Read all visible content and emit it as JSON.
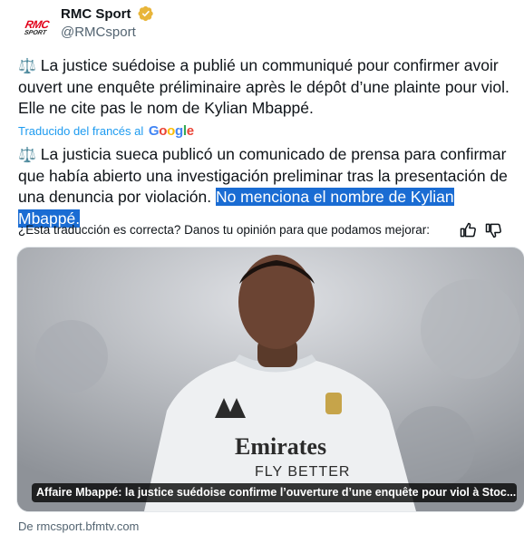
{
  "account": {
    "display_name": "RMC Sport",
    "handle": "@RMCsport",
    "avatar_text_top": "RMC",
    "avatar_text_bottom": "SPORT"
  },
  "tweet": {
    "emoji": "⚖️",
    "text": "La justice suédoise a publié un communiqué pour confirmer avoir ouvert une enquête préliminaire après le dépôt d’une plainte pour viol. Elle ne cite pas le nom de Kylian Mbappé."
  },
  "translation": {
    "label": "Traducido del francés al",
    "provider": "Google",
    "text_plain": "La justicia sueca publicó un comunicado de prensa para confirmar que había abierto una investigación preliminar tras la presentación de una denuncia por violación.",
    "text_highlighted": "No menciona el nombre de Kylian Mbappé."
  },
  "feedback": {
    "question": "¿Esta traducción es correcta? Danos tu opinión para que podamos mejorar:"
  },
  "media": {
    "caption": "Affaire Mbappé: la justice suédoise confirme l’ouverture d’une enquête pour viol à Stoc...",
    "shirt_text_1": "Emirates",
    "shirt_text_2": "FLY BETTER"
  },
  "source": {
    "label": "De rmcsport.bfmtv.com"
  },
  "colors": {
    "link_blue": "#1d9bf0",
    "highlight": "#1a6cd3",
    "verified_gold": "#e8b53a"
  }
}
